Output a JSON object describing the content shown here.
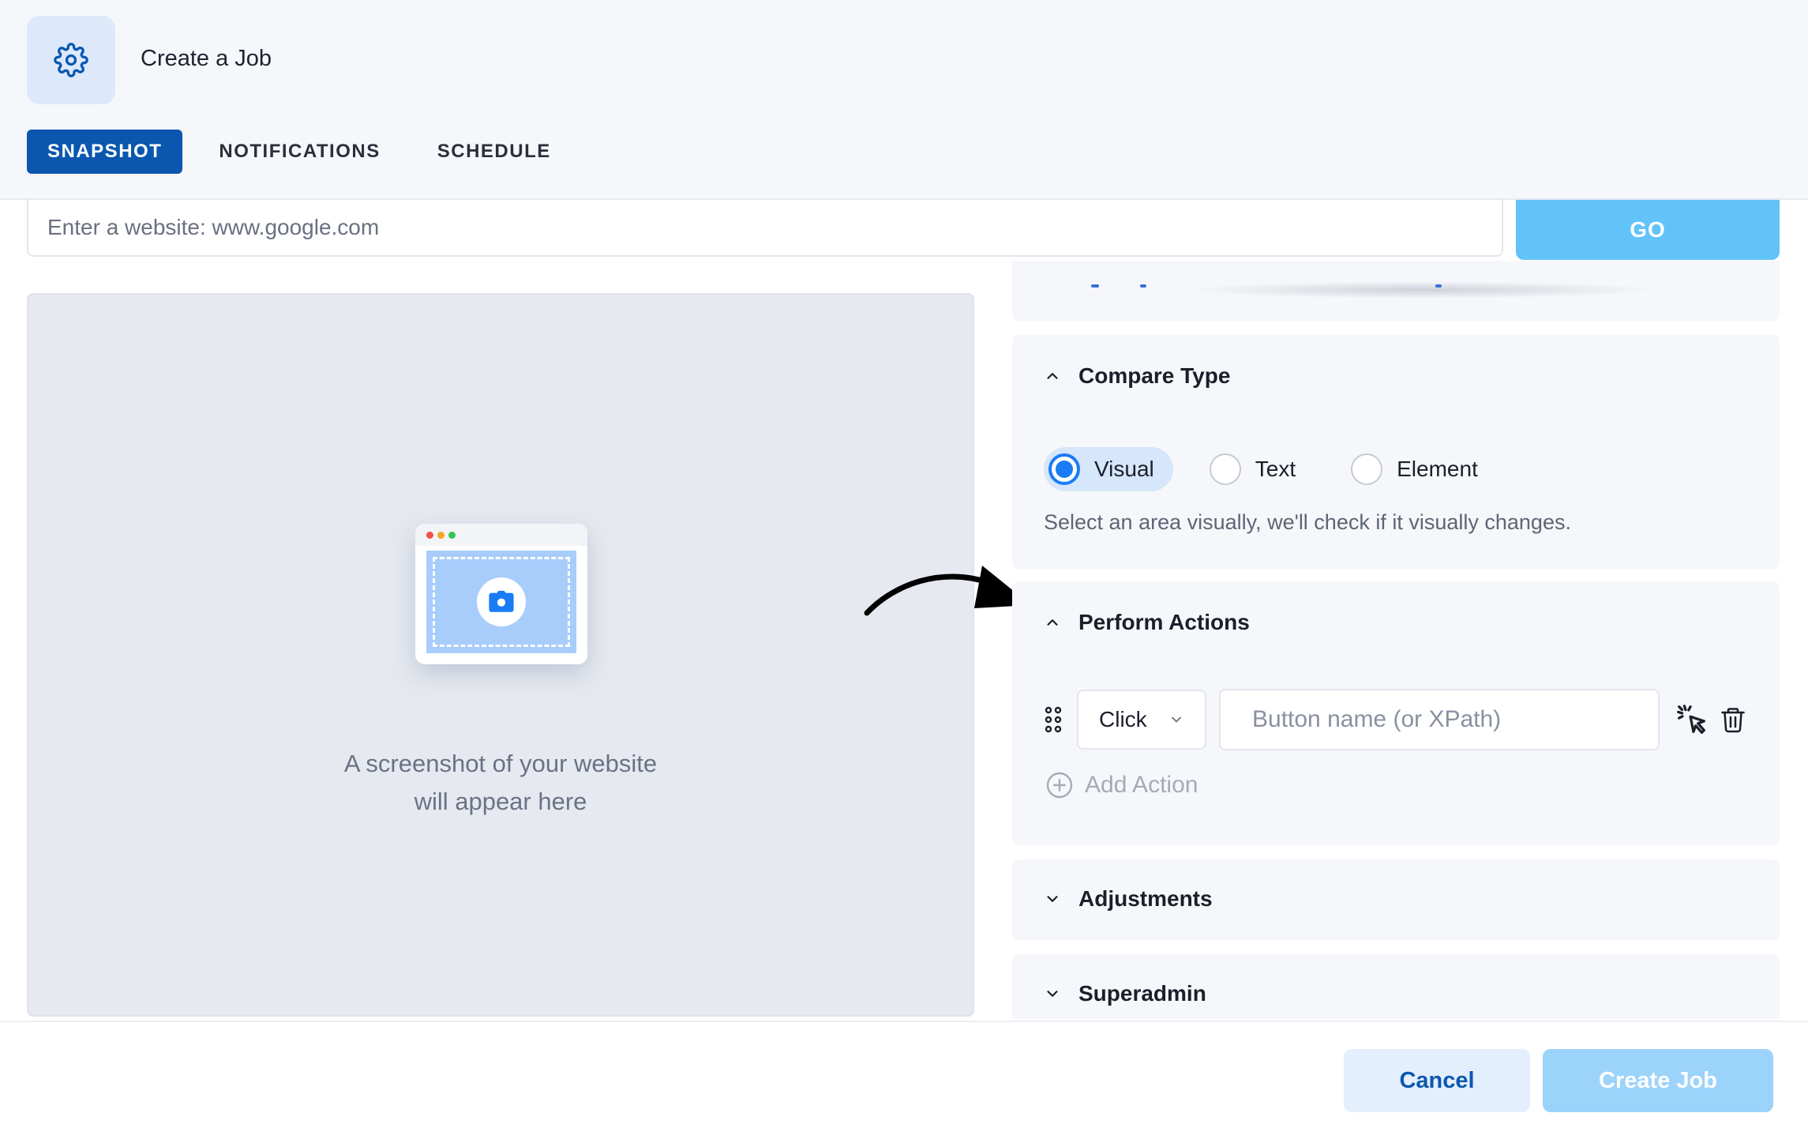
{
  "header": {
    "icon": "gear-icon",
    "title": "Create a Job",
    "tabs": [
      {
        "label": "SNAPSHOT",
        "active": true
      },
      {
        "label": "NOTIFICATIONS",
        "active": false
      },
      {
        "label": "SCHEDULE",
        "active": false
      }
    ]
  },
  "url_bar": {
    "placeholder": "Enter a website: www.google.com",
    "value": "",
    "go_label": "GO"
  },
  "preview": {
    "icon": "camera-icon",
    "caption_line1": "A screenshot of your website",
    "caption_line2": "will appear here"
  },
  "compare_type": {
    "title": "Compare Type",
    "expanded": true,
    "options": [
      {
        "label": "Visual",
        "selected": true
      },
      {
        "label": "Text",
        "selected": false
      },
      {
        "label": "Element",
        "selected": false
      }
    ],
    "hint": "Select an area visually, we'll check if it visually changes."
  },
  "perform_actions": {
    "title": "Perform Actions",
    "expanded": true,
    "action_type": "Click",
    "target_placeholder": "Button name (or XPath)",
    "add_label": "Add Action"
  },
  "adjustments": {
    "title": "Adjustments",
    "expanded": false
  },
  "superadmin": {
    "title": "Superadmin",
    "expanded": false
  },
  "footer": {
    "cancel_label": "Cancel",
    "create_label": "Create Job"
  },
  "colors": {
    "primary": "#0b57b0",
    "accent": "#62c3f9",
    "radio_selected": "#1a7cf5",
    "disabled_button": "#9bd3fb"
  }
}
